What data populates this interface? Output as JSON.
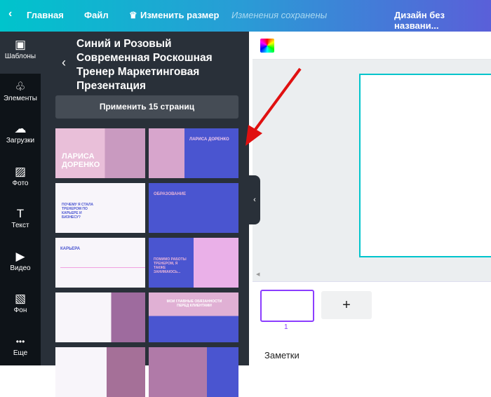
{
  "topbar": {
    "home": "Главная",
    "file": "Файл",
    "resize": "Изменить размер",
    "saved": "Изменения сохранены",
    "design_name": "Дизайн без названи..."
  },
  "rail": [
    {
      "label": "Шаблоны",
      "icon": "▣"
    },
    {
      "label": "Элементы",
      "icon": "♧"
    },
    {
      "label": "Загрузки",
      "icon": "☁"
    },
    {
      "label": "Фото",
      "icon": "▨"
    },
    {
      "label": "Текст",
      "icon": "T"
    },
    {
      "label": "Видео",
      "icon": "▶"
    },
    {
      "label": "Фон",
      "icon": "▧"
    },
    {
      "label": "Еще",
      "icon": "•••"
    }
  ],
  "panel": {
    "title": "Синий и Розовый Современная Роскошная Тренер Маркетинговая Презентация",
    "apply": "Применить 15 страниц"
  },
  "thumbs": [
    "ЛАРИСА ДОРЕНКО",
    "ЛАРИСА ДОРЕНКО",
    "ПОЧЕМУ Я СТАЛА ТРЕНЕРОМ ПО КАРЬЕРЕ И БИЗНЕСУ?",
    "ОБРАЗОВАНИЕ",
    "КАРЬЕРА",
    "ПОМИМО РАБОТЫ ТРЕНЕРОМ, Я ТАКЖЕ ЗАНИМАЮСЬ...",
    "",
    "МОИ ГЛАВНЫЕ ОБЯЗАННОСТИ ПЕРЕД КЛИЕНТАМИ",
    "",
    ""
  ],
  "pages": {
    "current": "1",
    "add": "+"
  },
  "notes": "Заметки",
  "colors": {
    "blue": "#4a55d0",
    "pink": "#e8b4d8",
    "dark": "#293039"
  }
}
